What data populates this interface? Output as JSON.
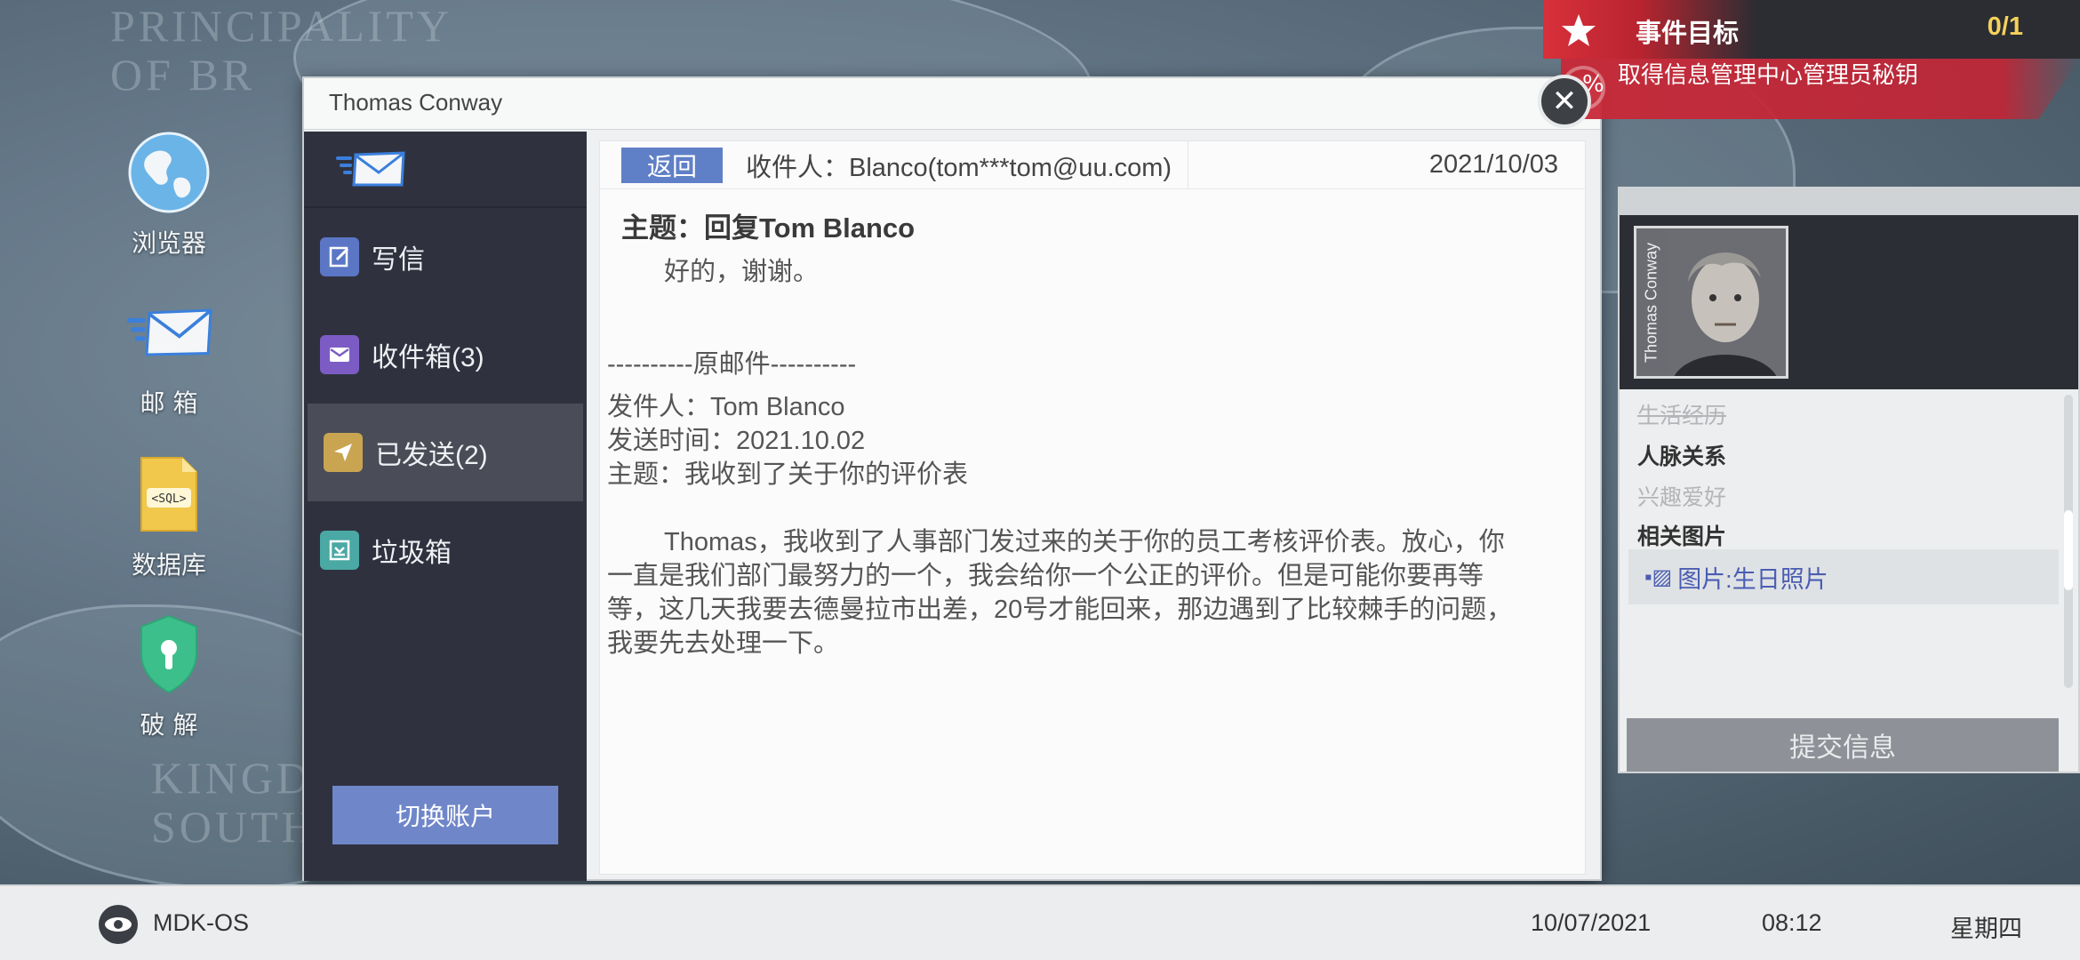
{
  "background": {
    "text_top": "PRINCIPALITY\nOF BR",
    "text_bottom": "KINGD\nSOUTH"
  },
  "desktop_icons": [
    {
      "label": "浏览器",
      "icon": "globe-icon"
    },
    {
      "label": "邮 箱",
      "icon": "mail-icon"
    },
    {
      "label": "数据库",
      "icon": "sql-file-icon"
    },
    {
      "label": "破 解",
      "icon": "shield-lock-icon"
    }
  ],
  "window": {
    "title": "Thomas Conway",
    "close_symbol": "✕"
  },
  "sidebar": {
    "items": [
      {
        "label": "写信",
        "icon": "compose-icon",
        "color": "#5b76c4"
      },
      {
        "label": "收件箱(3)",
        "icon": "inbox-icon",
        "color": "#7c5cc4"
      },
      {
        "label": "已发送(2)",
        "icon": "sent-icon",
        "color": "#c9a552"
      },
      {
        "label": "垃圾箱",
        "icon": "trash-icon",
        "color": "#4aa9a4"
      }
    ],
    "switch_account": "切换账户"
  },
  "email": {
    "back_label": "返回",
    "recipient": "收件人：Blanco(tom***tom@uu.com)",
    "date": "2021/10/03",
    "subject": "主题：回复Tom Blanco",
    "reply": "好的，谢谢。",
    "divider": "----------原邮件----------",
    "from": "发件人：Tom Blanco",
    "sent_time": "发送时间：2021.10.02",
    "orig_subject": "主题：我收到了关于你的评价表",
    "orig_body": "Thomas，我收到了人事部门发过来的关于你的员工考核评价表。放心，你一直是我们部门最努力的一个，我会给你一个公正的评价。但是可能你要再等等，这几天我要去德曼拉市出差，20号才能回来，那边遇到了比较棘手的问题，我要先去处理一下。"
  },
  "objective": {
    "title": "事件目标",
    "count": "0/1",
    "pct_symbol": "%",
    "text": "取得信息管理中心管理员秘钥",
    "accent": "#d8303b"
  },
  "info_panel": {
    "portrait_tag": "Thomas Conway",
    "rows": [
      {
        "label": "生活经历",
        "style": "dim"
      },
      {
        "label": "人脉关系",
        "style": "bold"
      },
      {
        "label": "兴趣爱好",
        "style": "dim"
      },
      {
        "label": "相关图片",
        "style": "bold"
      }
    ],
    "picture_item": "图片:生日照片",
    "submit": "提交信息"
  },
  "taskbar": {
    "os": "MDK-OS",
    "date": "10/07/2021",
    "time": "08:12",
    "weekday": "星期四"
  }
}
